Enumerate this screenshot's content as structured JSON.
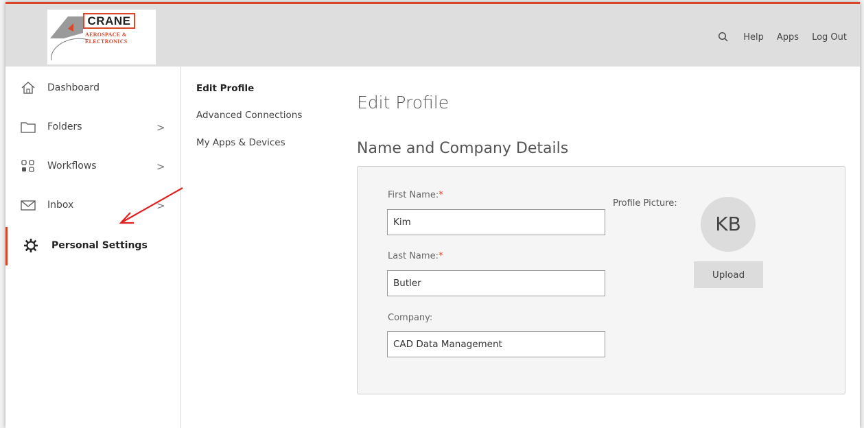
{
  "brand": {
    "logo_title": "CRANE",
    "logo_line1": "AEROSPACE &",
    "logo_line2": "ELECTRONICS",
    "accent_color": "#d9472b"
  },
  "topnav": {
    "search_icon": "search-icon",
    "help": "Help",
    "apps": "Apps",
    "logout": "Log Out"
  },
  "sidebar": {
    "items": [
      {
        "label": "Dashboard",
        "icon": "home-icon",
        "has_chevron": false
      },
      {
        "label": "Folders",
        "icon": "folder-icon",
        "has_chevron": true
      },
      {
        "label": "Workflows",
        "icon": "workflow-icon",
        "has_chevron": true
      },
      {
        "label": "Inbox",
        "icon": "mail-icon",
        "has_chevron": true
      },
      {
        "label": "Personal Settings",
        "icon": "gear-icon",
        "has_chevron": false,
        "active": true
      }
    ],
    "chevron": ">"
  },
  "subnav": {
    "items": [
      "Edit Profile",
      "Advanced Connections",
      "My Apps & Devices"
    ],
    "active_index": 0
  },
  "page": {
    "title": "Edit Profile",
    "section_title": "Name and Company Details"
  },
  "form": {
    "first_name_label": "First Name:",
    "first_name_value": "Kim",
    "last_name_label": "Last Name:",
    "last_name_value": "Butler",
    "company_label": "Company:",
    "company_value": "CAD Data Management",
    "required_marker": "*"
  },
  "profile_picture": {
    "label": "Profile Picture:",
    "initials": "KB",
    "upload_label": "Upload"
  }
}
